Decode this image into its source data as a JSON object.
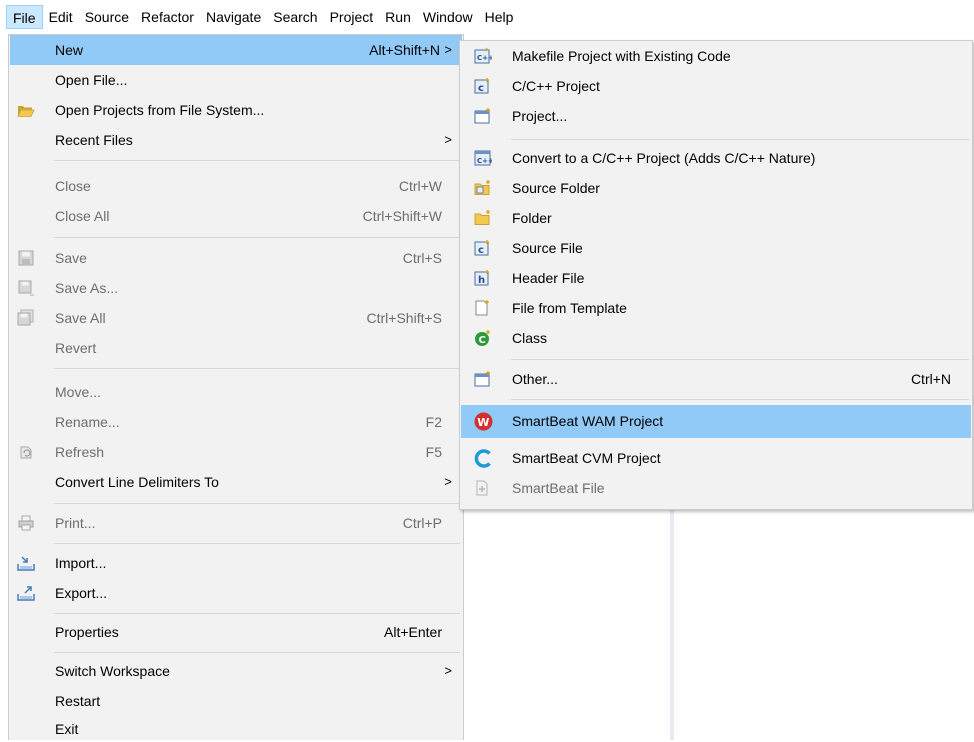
{
  "menubar": {
    "items": [
      "File",
      "Edit",
      "Source",
      "Refactor",
      "Navigate",
      "Search",
      "Project",
      "Run",
      "Window",
      "Help"
    ]
  },
  "file_menu": {
    "new": {
      "label": "New",
      "shortcut": "Alt+Shift+N",
      "arrow": ">"
    },
    "open_file": {
      "label": "Open File..."
    },
    "open_projects": {
      "label": "Open Projects from File System..."
    },
    "recent_files": {
      "label": "Recent Files",
      "arrow": ">"
    },
    "close": {
      "label": "Close",
      "shortcut": "Ctrl+W"
    },
    "close_all": {
      "label": "Close All",
      "shortcut": "Ctrl+Shift+W"
    },
    "save": {
      "label": "Save",
      "shortcut": "Ctrl+S"
    },
    "save_as": {
      "label": "Save As..."
    },
    "save_all": {
      "label": "Save All",
      "shortcut": "Ctrl+Shift+S"
    },
    "revert": {
      "label": "Revert"
    },
    "move": {
      "label": "Move..."
    },
    "rename": {
      "label": "Rename...",
      "shortcut": "F2"
    },
    "refresh": {
      "label": "Refresh",
      "shortcut": "F5"
    },
    "convert_line_delimiters": {
      "label": "Convert Line Delimiters To",
      "arrow": ">"
    },
    "print": {
      "label": "Print...",
      "shortcut": "Ctrl+P"
    },
    "import": {
      "label": "Import..."
    },
    "export": {
      "label": "Export..."
    },
    "properties": {
      "label": "Properties",
      "shortcut": "Alt+Enter"
    },
    "switch_workspace": {
      "label": "Switch Workspace",
      "arrow": ">"
    },
    "restart": {
      "label": "Restart"
    },
    "exit": {
      "label": "Exit"
    }
  },
  "new_menu": {
    "makefile_project": {
      "label": "Makefile Project with Existing Code"
    },
    "cpp_project": {
      "label": "C/C++ Project"
    },
    "project": {
      "label": "Project..."
    },
    "convert_cpp": {
      "label": "Convert to a C/C++ Project (Adds C/C++ Nature)"
    },
    "source_folder": {
      "label": "Source Folder"
    },
    "folder": {
      "label": "Folder"
    },
    "source_file": {
      "label": "Source File"
    },
    "header_file": {
      "label": "Header File"
    },
    "file_from_template": {
      "label": "File from Template"
    },
    "class": {
      "label": "Class"
    },
    "other": {
      "label": "Other...",
      "shortcut": "Ctrl+N"
    },
    "smartbeat_wam": {
      "label": "SmartBeat WAM Project"
    },
    "smartbeat_cvm": {
      "label": "SmartBeat CVM Project"
    },
    "smartbeat_file": {
      "label": "SmartBeat File"
    }
  },
  "icons": {
    "folder_open": "folder-open-icon",
    "cpp_project": "cpp-project-icon",
    "wam_logo": "wam-logo-icon",
    "cvm_logo": "cvm-logo-icon"
  },
  "colors": {
    "menu_bg": "#f2f2f2",
    "highlight": "#91c9f7",
    "disabled_text": "#6d6d6d",
    "menubar_active": "#cce8ff",
    "wam_red": "#d32f2f",
    "cvm_blue": "#1e9ad6",
    "class_green": "#2e9b3a"
  }
}
